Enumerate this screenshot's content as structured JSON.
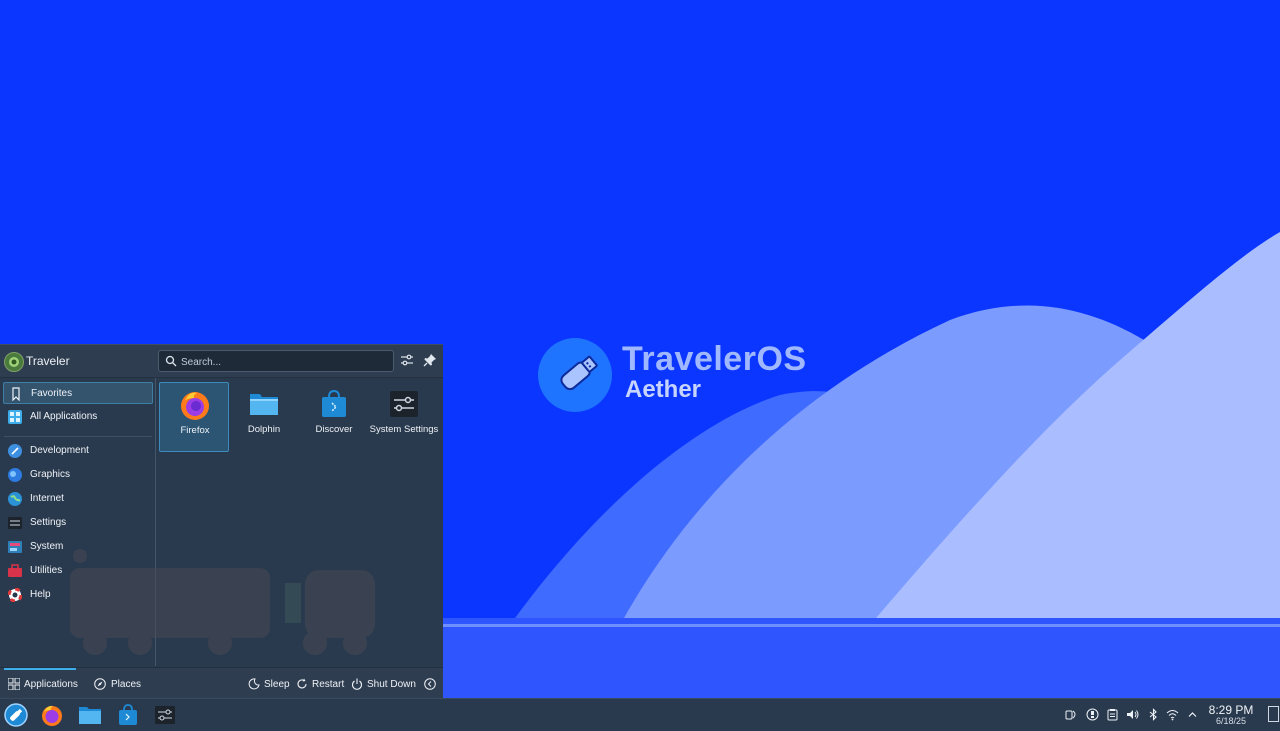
{
  "wallpaper": {
    "brand_title": "TravelerOS",
    "brand_subtitle": "Aether",
    "colors": {
      "sky": "#0a36ff",
      "mountain_far": "#3f6bff",
      "mountain_mid": "#7c9bff",
      "mountain_near": "#a9bdff",
      "water": "#2f55ff"
    }
  },
  "launcher": {
    "user_name": "Traveler",
    "search": {
      "placeholder": "Search...",
      "value": ""
    },
    "header_buttons": [
      {
        "icon": "configure-icon"
      },
      {
        "icon": "pin-icon"
      }
    ],
    "categories": [
      {
        "label": "Favorites",
        "icon": "bookmark-icon",
        "active": true
      },
      {
        "label": "All Applications",
        "icon": "grid-icon",
        "active": false
      },
      {
        "label": "Development",
        "icon": "development-icon",
        "active": false
      },
      {
        "label": "Graphics",
        "icon": "graphics-icon",
        "active": false
      },
      {
        "label": "Internet",
        "icon": "globe-icon",
        "active": false
      },
      {
        "label": "Settings",
        "icon": "settings-icon",
        "active": false
      },
      {
        "label": "System",
        "icon": "system-icon",
        "active": false
      },
      {
        "label": "Utilities",
        "icon": "utilities-icon",
        "active": false
      },
      {
        "label": "Help",
        "icon": "help-icon",
        "active": false
      }
    ],
    "favorites": [
      {
        "label": "Firefox",
        "icon": "firefox-icon",
        "selected": true
      },
      {
        "label": "Dolphin",
        "icon": "folder-icon",
        "selected": false
      },
      {
        "label": "Discover",
        "icon": "discover-icon",
        "selected": false
      },
      {
        "label": "System Settings",
        "icon": "system-settings-icon",
        "selected": false
      }
    ],
    "footer": {
      "tabs": [
        {
          "label": "Applications",
          "icon": "grid-icon",
          "active": true
        },
        {
          "label": "Places",
          "icon": "compass-icon",
          "active": false
        }
      ],
      "power": [
        {
          "label": "Sleep",
          "icon": "sleep-icon"
        },
        {
          "label": "Restart",
          "icon": "restart-icon"
        },
        {
          "label": "Shut Down",
          "icon": "power-icon"
        }
      ]
    }
  },
  "taskbar": {
    "launchers": [
      {
        "icon": "start-menu-icon"
      },
      {
        "icon": "firefox-icon"
      },
      {
        "icon": "folder-icon"
      },
      {
        "icon": "discover-icon"
      },
      {
        "icon": "system-settings-icon"
      }
    ],
    "tray": [
      {
        "icon": "kde-connect-icon"
      },
      {
        "icon": "update-icon"
      },
      {
        "icon": "clipboard-icon"
      },
      {
        "icon": "volume-icon"
      },
      {
        "icon": "bluetooth-icon"
      },
      {
        "icon": "wifi-icon"
      },
      {
        "icon": "chevron-up-icon"
      }
    ],
    "clock": {
      "time": "8:29 PM",
      "date": "6/18/25"
    }
  }
}
